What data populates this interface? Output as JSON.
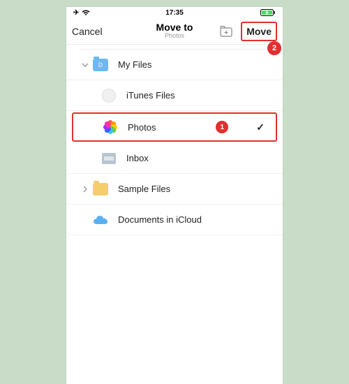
{
  "statusbar": {
    "time": "17:35",
    "airplane": "✈",
    "wifi": "wifi",
    "battery": "charging"
  },
  "navbar": {
    "cancel": "Cancel",
    "title": "Move to",
    "subtitle": "Photos",
    "move": "Move",
    "move_badge": "2"
  },
  "rows": {
    "myfiles": "My Files",
    "itunes": "iTunes Files",
    "photos": "Photos",
    "photos_badge": "1",
    "inbox": "Inbox",
    "sample": "Sample Files",
    "icloud": "Documents in iCloud"
  },
  "checkmark": "✓"
}
